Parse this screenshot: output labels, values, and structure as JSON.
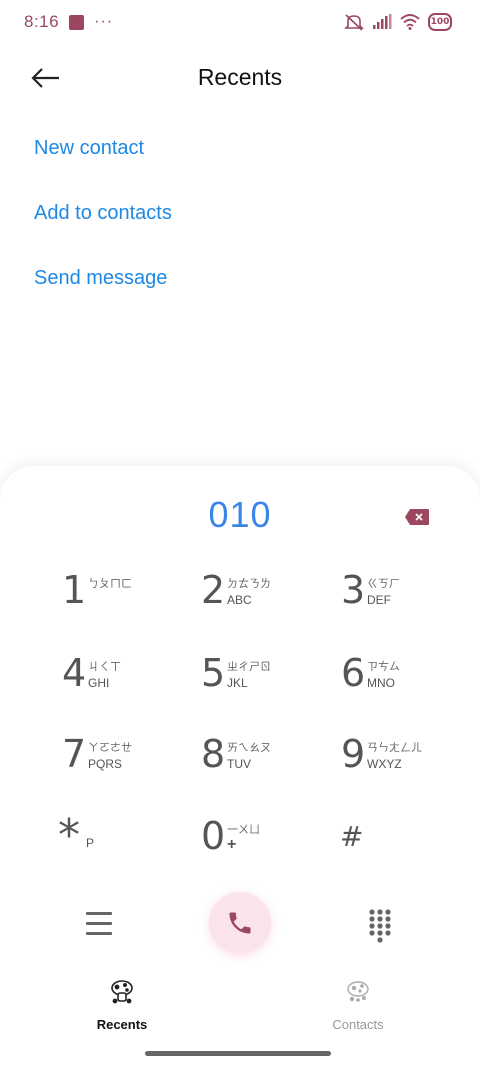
{
  "status_bar": {
    "time": "8:16",
    "dots": "···",
    "battery": "100",
    "icons": [
      "app-notification-icon",
      "mute-icon",
      "signal-icon",
      "wifi-icon",
      "battery-icon"
    ],
    "accent_color": "#9b4760"
  },
  "header": {
    "title": "Recents"
  },
  "actions": {
    "new_contact": "New contact",
    "add_to_contacts": "Add to contacts",
    "send_message": "Send message"
  },
  "dialer": {
    "number": "010",
    "keys": [
      {
        "digit": "1",
        "top": "ㄅㄆㄇㄈ",
        "letters": ""
      },
      {
        "digit": "2",
        "top": "ㄉㄊㄋㄌ",
        "letters": "ABC"
      },
      {
        "digit": "3",
        "top": "ㄍㄎㄏ",
        "letters": "DEF"
      },
      {
        "digit": "4",
        "top": "ㄐㄑㄒ",
        "letters": "GHI"
      },
      {
        "digit": "5",
        "top": "ㄓㄔㄕㄖ",
        "letters": "JKL"
      },
      {
        "digit": "6",
        "top": "ㄗㄘㄙ",
        "letters": "MNO"
      },
      {
        "digit": "7",
        "top": "ㄚㄛㄜㄝ",
        "letters": "PQRS"
      },
      {
        "digit": "8",
        "top": "ㄞㄟㄠㄡ",
        "letters": "TUV"
      },
      {
        "digit": "9",
        "top": "ㄢㄣㄤㄥㄦ",
        "letters": "WXYZ"
      },
      {
        "digit": "*",
        "top": "",
        "letters": "P"
      },
      {
        "digit": "0",
        "top": "一ㄨㄩ",
        "letters": "+"
      },
      {
        "digit": "#",
        "top": "",
        "letters": ""
      }
    ],
    "number_color": "#3a86e8",
    "call_button_color": "#fbe3ec",
    "call_icon_color": "#9b4760"
  },
  "bottom_nav": {
    "recents": "Recents",
    "contacts": "Contacts"
  }
}
